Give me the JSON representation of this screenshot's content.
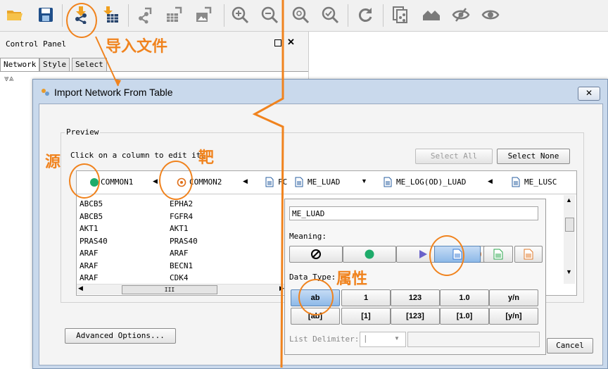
{
  "control_panel": {
    "title": "Control Panel",
    "tabs": [
      "Network",
      "Style",
      "Select"
    ]
  },
  "dialog": {
    "title": "Import Network From Table",
    "preview_label": "Preview",
    "hint": "Click on a column to edit it.",
    "select_all": "Select All",
    "select_none": "Select None",
    "columns": [
      "COMMON1",
      "COMMON2",
      "FC",
      "ME_LUAD",
      "ME_LOG(OD)_LUAD",
      "ME_LUSC"
    ],
    "col1_rows": [
      "ABCB5",
      "ABCB5",
      "AKT1",
      "PRAS40",
      "ARAF",
      "ARAF",
      "ARAF"
    ],
    "col2_rows": [
      "EPHA2",
      "FGFR4",
      "AKT1",
      "PRAS40",
      "ARAF",
      "BECN1",
      "CDK4"
    ],
    "scroll_mark": "III",
    "advanced": "Advanced Options...",
    "cancel": "Cancel"
  },
  "popup": {
    "name_value": "ME_LUAD",
    "meaning_label": "Meaning:",
    "data_type_label": "Data Type:",
    "types_row1": [
      "ab",
      "1",
      "123",
      "1.0",
      "y/n"
    ],
    "types_row2": [
      "[ab]",
      "[1]",
      "[123]",
      "[1.0]",
      "[y/n]"
    ],
    "list_delim_label": "List Delimiter:",
    "list_delim_value": "|"
  },
  "annotations": {
    "import_file": "导入文件",
    "source": "源",
    "target": "靶",
    "attribute": "属性"
  },
  "colors": {
    "accent": "#f0831e",
    "source_green": "#1eab6a",
    "target_orange": "#e0701a",
    "edge_purple": "#6a62c9",
    "doc_blue": "#3a7bd5",
    "doc_green": "#2ea84f",
    "doc_orange": "#e07a2a"
  }
}
